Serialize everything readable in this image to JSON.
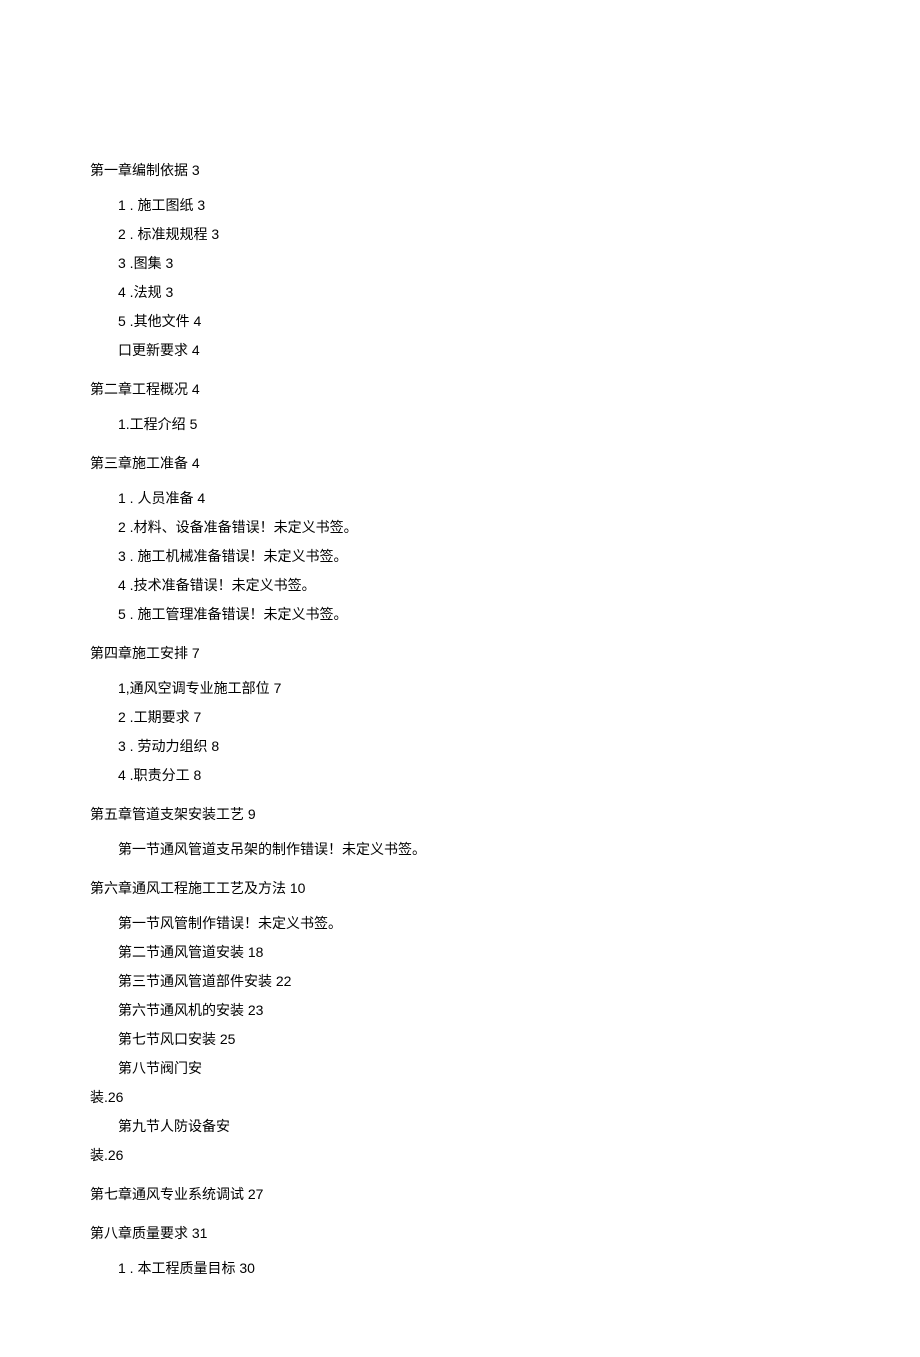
{
  "chapters": [
    {
      "title": "第一章编制依据 3",
      "items": [
        "1 . 施工图纸 3",
        "2 . 标准规规程 3",
        "3 .图集 3",
        "4 .法规 3",
        "5 .其他文件 4",
        "口更新要求 4"
      ]
    },
    {
      "title": "第二章工程概况 4",
      "items": [
        "1.工程介绍 5"
      ]
    },
    {
      "title": "第三章施工准备 4",
      "items": [
        "1 . 人员准备 4",
        "2 .材料、设备准备错误！未定义书签。",
        "3 . 施工机械准备错误！未定义书签。",
        "4 .技术准备错误！未定义书签。",
        "5 . 施工管理准备错误！未定义书签。"
      ]
    },
    {
      "title": "第四章施工安排 7",
      "items": [
        "1,通风空调专业施工部位 7",
        "2 .工期要求 7",
        "3 . 劳动力组织 8",
        "4 .职责分工 8"
      ]
    },
    {
      "title": "第五章管道支架安装工艺 9",
      "items": [
        "第一节通风管道支吊架的制作错误！未定义书签。"
      ]
    },
    {
      "title": "第六章通风工程施工工艺及方法 10",
      "items": [
        "第一节风管制作错误！未定义书签。",
        "第二节通风管道安装 18",
        "第三节通风管道部件安装 22",
        "第六节通风机的安装 23",
        "第七节风口安装 25",
        "第八节阀门安"
      ],
      "continuation1": "装.26",
      "items2": [
        "第九节人防设备安"
      ],
      "continuation2": "装.26"
    },
    {
      "title": "第七章通风专业系统调试 27",
      "items": []
    },
    {
      "title": "第八章质量要求 31",
      "items": [
        "1 . 本工程质量目标 30"
      ]
    }
  ]
}
